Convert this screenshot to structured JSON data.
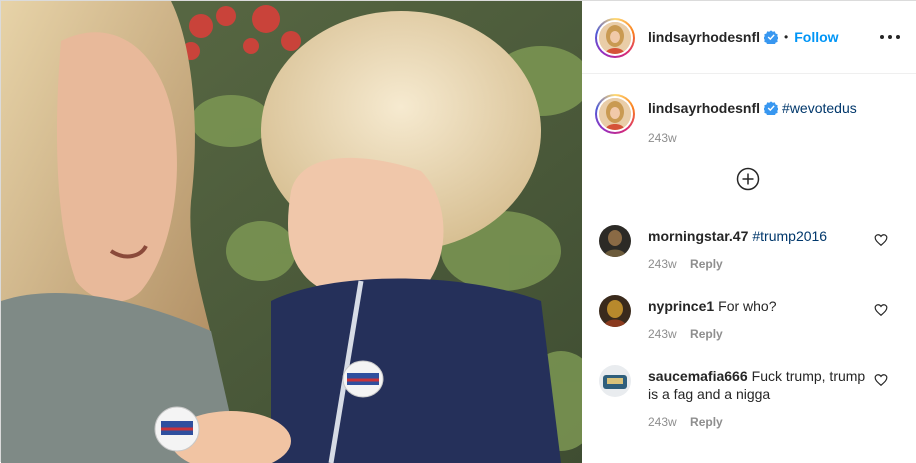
{
  "post": {
    "author": "lindsayrhodesnfl",
    "follow_label": "Follow",
    "separator": "•"
  },
  "caption": {
    "username": "lindsayrhodesnfl",
    "hashtag": "#wevotedus",
    "time": "243w"
  },
  "comments": [
    {
      "username": "morningstar.47",
      "text": "#trump2016",
      "text_is_hashtag": true,
      "time": "243w",
      "reply_label": "Reply"
    },
    {
      "username": "nyprince1",
      "text": "For who?",
      "text_is_hashtag": false,
      "time": "243w",
      "reply_label": "Reply"
    },
    {
      "username": "saucemafia666",
      "text": "Fuck trump, trump is a fag and a nigga",
      "text_is_hashtag": false,
      "time": "243w",
      "reply_label": "Reply"
    }
  ],
  "icons": {
    "verified": "verified-badge-icon",
    "more": "more-options-icon",
    "load_more": "plus-circle-icon",
    "like": "heart-icon"
  },
  "colors": {
    "link_blue": "#0095f6",
    "hashtag_blue": "#00376b",
    "muted_gray": "#8e8e8e",
    "text": "#262626",
    "verified_blue": "#3897f0"
  }
}
